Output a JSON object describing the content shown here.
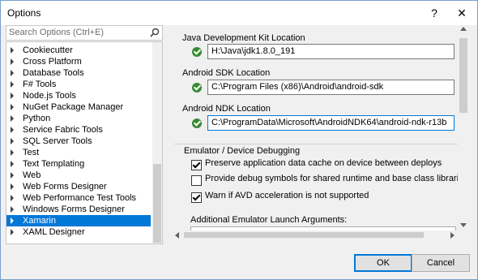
{
  "window": {
    "title": "Options",
    "help_glyph": "?",
    "close_glyph": "✕"
  },
  "search": {
    "placeholder": "Search Options (Ctrl+E)",
    "icon": "search-icon"
  },
  "tree": {
    "items": [
      {
        "label": "Cookiecutter"
      },
      {
        "label": "Cross Platform"
      },
      {
        "label": "Database Tools"
      },
      {
        "label": "F# Tools"
      },
      {
        "label": "Node.js Tools"
      },
      {
        "label": "NuGet Package Manager"
      },
      {
        "label": "Python"
      },
      {
        "label": "Service Fabric Tools"
      },
      {
        "label": "SQL Server Tools"
      },
      {
        "label": "Test"
      },
      {
        "label": "Text Templating"
      },
      {
        "label": "Web"
      },
      {
        "label": "Web Forms Designer"
      },
      {
        "label": "Web Performance Test Tools"
      },
      {
        "label": "Windows Forms Designer"
      },
      {
        "label": "Xamarin",
        "selected": true
      },
      {
        "label": "XAML Designer"
      }
    ]
  },
  "fields": [
    {
      "label": "Java Development Kit Location",
      "value": "H:\\Java\\jdk1.8.0_191",
      "status": "valid"
    },
    {
      "label": "Android SDK Location",
      "value": "C:\\Program Files (x86)\\Android\\android-sdk",
      "status": "valid"
    },
    {
      "label": "Android NDK Location",
      "value": "C:\\ProgramData\\Microsoft\\AndroidNDK64\\android-ndk-r13b",
      "status": "valid"
    }
  ],
  "emulator": {
    "title": "Emulator / Device Debugging",
    "options": [
      {
        "label": "Preserve application data cache on device between deploys",
        "checked": true
      },
      {
        "label": "Provide debug symbols for shared runtime and base class libraries",
        "checked": false
      },
      {
        "label": "Warn if AVD acceleration is not supported",
        "checked": true
      }
    ],
    "args_label": "Additional Emulator Launch Arguments:"
  },
  "buttons": {
    "ok": "OK",
    "cancel": "Cancel"
  },
  "colors": {
    "accent": "#0078d7",
    "valid": "#388a34"
  }
}
